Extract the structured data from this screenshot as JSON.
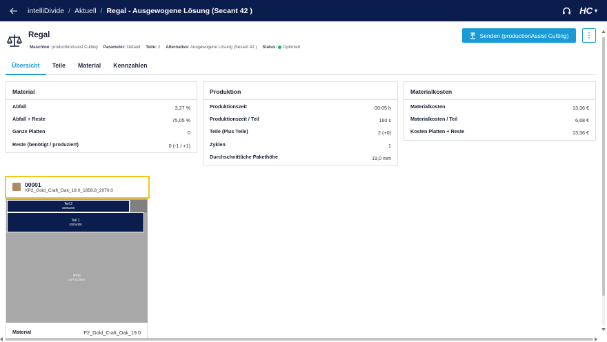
{
  "topbar": {
    "back_icon": "arrow-left-icon",
    "breadcrumb": [
      "intelliDivide",
      "Aktuell",
      "Regal - Ausgewogene Lösung (Secant 42 )"
    ],
    "separator": "/",
    "support_icon": "headset-icon",
    "logo_text": "HC",
    "logo_caret": "▾"
  },
  "header": {
    "title": "Regal",
    "meta": [
      {
        "label": "Maschine:",
        "value": "productionAssist Cutting"
      },
      {
        "label": "Parameter:",
        "value": "Default"
      },
      {
        "label": "Teile:",
        "value": "2"
      },
      {
        "label": "Alternative:",
        "value": "Ausgewogene Lösung (Secant 42 )"
      },
      {
        "label": "Status:",
        "value": "Optimiert"
      }
    ],
    "status_color": "#1db36a",
    "send_button": "Senden (productionAssist Cutting)",
    "more_button": "⋮"
  },
  "tabs": [
    {
      "label": "Übersicht",
      "active": true
    },
    {
      "label": "Teile",
      "active": false
    },
    {
      "label": "Material",
      "active": false
    },
    {
      "label": "Kennzahlen",
      "active": false
    }
  ],
  "cards": {
    "material": {
      "title": "Material",
      "rows": [
        {
          "label": "Abfall",
          "value": "3,27 %"
        },
        {
          "label": "Abfall + Reste",
          "value": "75,05 %"
        },
        {
          "label": "Ganze Platten",
          "value": "0"
        },
        {
          "label": "Reste (benötigt / produziert)",
          "value": "0 (-1 / +1)"
        }
      ]
    },
    "produktion": {
      "title": "Produktion",
      "rows": [
        {
          "label": "Produktionszeit",
          "value": "00:05 h"
        },
        {
          "label": "Produktionszeit / Teil",
          "value": "160 s"
        },
        {
          "label": "Teile (Plus Teile)",
          "value": "2 (+0)"
        },
        {
          "label": "Zyklen",
          "value": "1"
        },
        {
          "label": "Durchschnittliche Pakethöhe",
          "value": "19,0 mm"
        }
      ]
    },
    "kosten": {
      "title": "Materialkosten",
      "rows": [
        {
          "label": "Materialkosten",
          "value": "13,36 €"
        },
        {
          "label": "Materialkosten / Teil",
          "value": "6,68 €"
        },
        {
          "label": "Kosten Platten + Reste",
          "value": "13,36 €"
        }
      ]
    }
  },
  "plate": {
    "id": "00001",
    "subtitle": "XP2_Gold_Craft_Oak_19.0_1858.8_2070.0",
    "swatch_color": "#b08a62",
    "parts": [
      {
        "name": "Teil 2",
        "dims": "1800x200"
      },
      {
        "name": "Teil 1",
        "dims": "2000x300"
      }
    ],
    "offcut": {
      "name": "Rest",
      "dims": "2070x1356.8"
    },
    "footer_label": "Material",
    "footer_value": "P2_Gold_Craft_Oak_19.0"
  },
  "colors": {
    "topbar": "#0b1d4d",
    "accent": "#1a9bd7",
    "highlight": "#f5c518",
    "part_fill": "#0b1d4d",
    "offcut_fill": "#a8a8a8"
  }
}
